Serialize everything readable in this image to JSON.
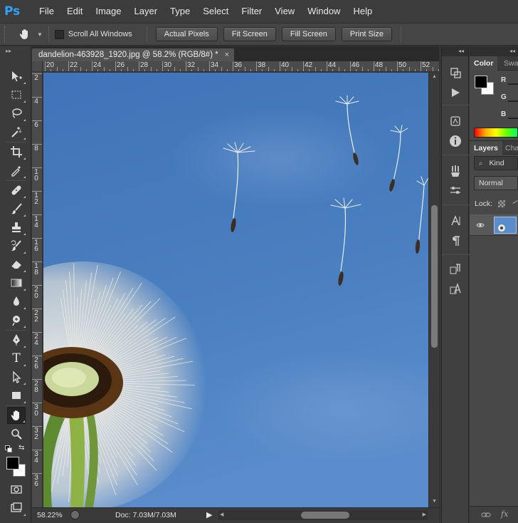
{
  "app": {
    "logo": "Ps",
    "menu": [
      "File",
      "Edit",
      "Image",
      "Layer",
      "Type",
      "Select",
      "Filter",
      "View",
      "Window",
      "Help"
    ]
  },
  "options_bar": {
    "tool_icon": "hand-icon",
    "scroll_all_windows": {
      "label": "Scroll All Windows",
      "checked": false
    },
    "buttons": [
      "Actual Pixels",
      "Fit Screen",
      "Fill Screen",
      "Print Size"
    ]
  },
  "toolbar": {
    "collapse_glyph": "▸▸",
    "tools": [
      {
        "name": "move-tool",
        "icon": "move-icon"
      },
      {
        "name": "marquee-tool",
        "icon": "marquee-icon"
      },
      {
        "name": "lasso-tool",
        "icon": "lasso-icon"
      },
      {
        "name": "magic-wand-tool",
        "icon": "magic-wand-icon"
      },
      {
        "name": "crop-tool",
        "icon": "crop-icon"
      },
      {
        "name": "eyedropper-tool",
        "icon": "eyedropper-icon"
      },
      {
        "name": "healing-brush-tool",
        "icon": "bandage-icon"
      },
      {
        "name": "brush-tool",
        "icon": "brush-icon"
      },
      {
        "name": "clone-stamp-tool",
        "icon": "stamp-icon"
      },
      {
        "name": "history-brush-tool",
        "icon": "history-brush-icon"
      },
      {
        "name": "eraser-tool",
        "icon": "eraser-icon"
      },
      {
        "name": "gradient-tool",
        "icon": "gradient-icon"
      },
      {
        "name": "blur-tool",
        "icon": "drop-icon"
      },
      {
        "name": "dodge-tool",
        "icon": "dodge-icon"
      },
      {
        "name": "pen-tool",
        "icon": "pen-icon"
      },
      {
        "name": "type-tool",
        "icon": "type-icon",
        "glyph": "T"
      },
      {
        "name": "path-selection-tool",
        "icon": "arrow-icon"
      },
      {
        "name": "shape-tool",
        "icon": "rectangle-icon"
      },
      {
        "name": "hand-tool",
        "icon": "hand-icon",
        "active": true
      },
      {
        "name": "zoom-tool",
        "icon": "zoom-icon"
      }
    ]
  },
  "document": {
    "tab_title": "dandelion-463928_1920.jpg @ 58.2% (RGB/8#) *",
    "close_glyph": "×",
    "ruler_h": [
      "20",
      "22",
      "24",
      "26",
      "28",
      "30",
      "32",
      "34",
      "36",
      "38",
      "40",
      "42",
      "44",
      "46",
      "48",
      "50",
      "52"
    ],
    "ruler_v": [
      "2",
      "4",
      "6",
      "8",
      "1 0",
      "1 2",
      "1 4",
      "1 6",
      "1 8",
      "2 0",
      "2 2",
      "2 4",
      "2 6",
      "2 8",
      "3 0",
      "3 2",
      "3 4",
      "3 6"
    ]
  },
  "status": {
    "zoom": "58.22%",
    "doc": "Doc: 7.03M/7.03M",
    "arrow": "▶"
  },
  "middle_dock": {
    "collapse_glyph": "◂◂",
    "icons": [
      "history-icon",
      "actions-icon",
      "adjustments-icon",
      "info-icon",
      "brush-presets-icon",
      "brush-settings-icon",
      "character-icon",
      "paragraph-icon",
      "paragraph-styles-icon",
      "character-styles-icon"
    ]
  },
  "right_dock": {
    "collapse_glyph": "◂◂",
    "color_tabs": [
      "Color",
      "Swa"
    ],
    "rgb_labels": [
      "R",
      "G",
      "B"
    ],
    "layers_tabs": [
      "Layers",
      "Cha"
    ],
    "kind_filter": "Kind",
    "blend_mode": "Normal",
    "lock_label": "Lock:",
    "colors": {
      "foreground": "#000000",
      "background": "#ffffff"
    }
  }
}
